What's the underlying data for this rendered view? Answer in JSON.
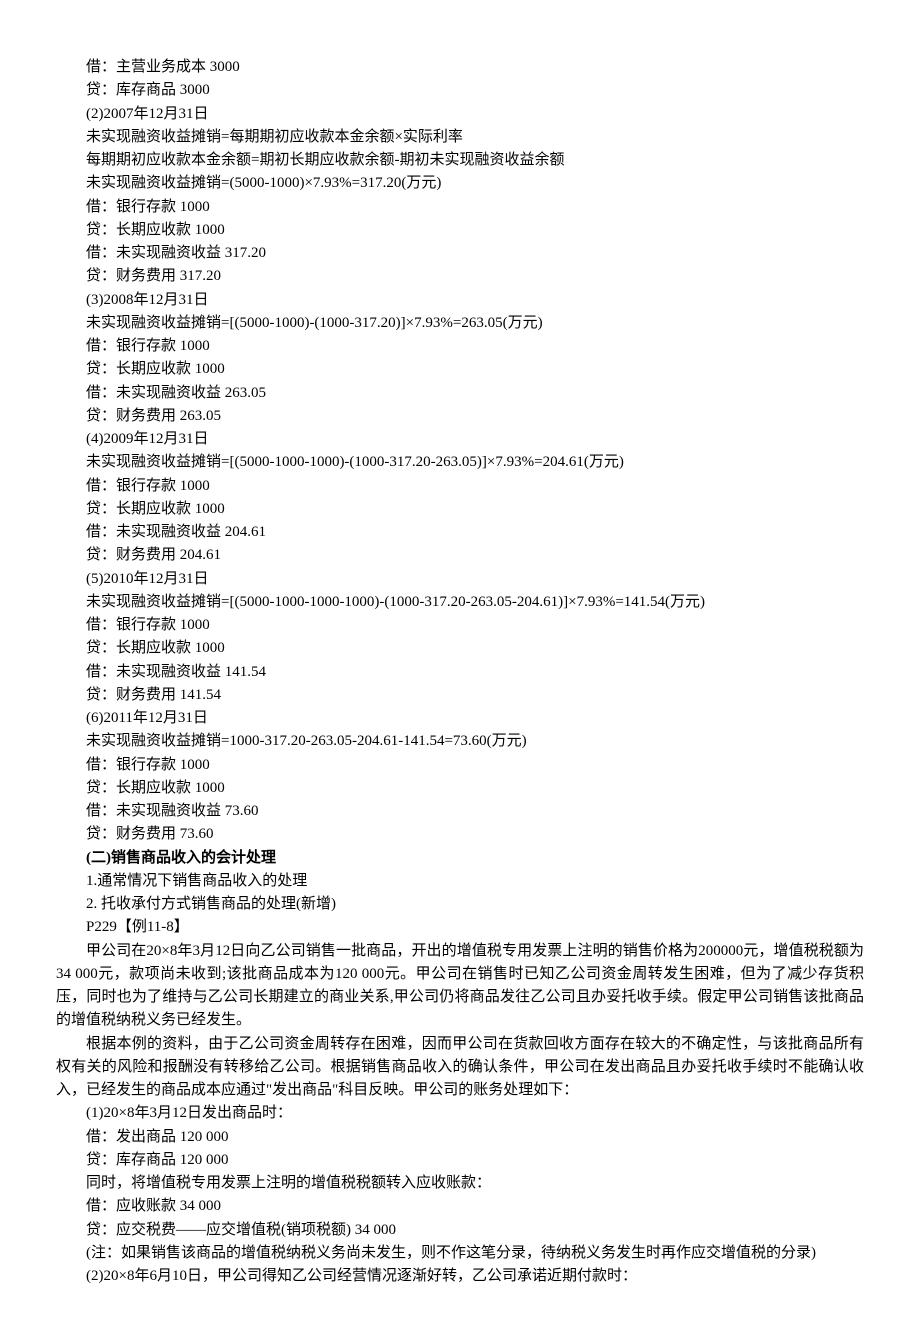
{
  "lines": [
    {
      "t": "借：主营业务成本 3000",
      "cls": "line"
    },
    {
      "t": "贷：库存商品 3000",
      "cls": "line"
    },
    {
      "t": "(2)2007年12月31日",
      "cls": "line"
    },
    {
      "t": "未实现融资收益摊销=每期期初应收款本金余额×实际利率",
      "cls": "line"
    },
    {
      "t": "每期期初应收款本金余额=期初长期应收款余额-期初未实现融资收益余额",
      "cls": "line"
    },
    {
      "t": "未实现融资收益摊销=(5000-1000)×7.93%=317.20(万元)",
      "cls": "line"
    },
    {
      "t": "借：银行存款 1000",
      "cls": "line"
    },
    {
      "t": "贷：长期应收款 1000",
      "cls": "line"
    },
    {
      "t": "借：未实现融资收益 317.20",
      "cls": "line"
    },
    {
      "t": "贷：财务费用 317.20",
      "cls": "line"
    },
    {
      "t": "(3)2008年12月31日",
      "cls": "line"
    },
    {
      "t": "未实现融资收益摊销=[(5000-1000)-(1000-317.20)]×7.93%=263.05(万元)",
      "cls": "line"
    },
    {
      "t": "借：银行存款 1000",
      "cls": "line"
    },
    {
      "t": "贷：长期应收款 1000",
      "cls": "line"
    },
    {
      "t": "借：未实现融资收益 263.05",
      "cls": "line"
    },
    {
      "t": "贷：财务费用 263.05",
      "cls": "line"
    },
    {
      "t": "(4)2009年12月31日",
      "cls": "line"
    },
    {
      "t": "未实现融资收益摊销=[(5000-1000-1000)-(1000-317.20-263.05)]×7.93%=204.61(万元)",
      "cls": "line"
    },
    {
      "t": "借：银行存款 1000",
      "cls": "line"
    },
    {
      "t": "贷：长期应收款 1000",
      "cls": "line"
    },
    {
      "t": "借：未实现融资收益 204.61",
      "cls": "line"
    },
    {
      "t": "贷：财务费用 204.61",
      "cls": "line"
    },
    {
      "t": "(5)2010年12月31日",
      "cls": "line"
    },
    {
      "t": "未实现融资收益摊销=[(5000-1000-1000-1000)-(1000-317.20-263.05-204.61)]×7.93%=141.54(万元)",
      "cls": "line"
    },
    {
      "t": "借：银行存款 1000",
      "cls": "line"
    },
    {
      "t": "贷：长期应收款 1000",
      "cls": "line"
    },
    {
      "t": "借：未实现融资收益 141.54",
      "cls": "line"
    },
    {
      "t": "贷：财务费用 141.54",
      "cls": "line"
    },
    {
      "t": "(6)2011年12月31日",
      "cls": "line"
    },
    {
      "t": "未实现融资收益摊销=1000-317.20-263.05-204.61-141.54=73.60(万元)",
      "cls": "line"
    },
    {
      "t": "借：银行存款 1000",
      "cls": "line"
    },
    {
      "t": "贷：长期应收款 1000",
      "cls": "line"
    },
    {
      "t": "借：未实现融资收益 73.60",
      "cls": "line"
    },
    {
      "t": "贷：财务费用 73.60",
      "cls": "line"
    },
    {
      "t": "(二)销售商品收入的会计处理",
      "cls": "line bold"
    },
    {
      "t": "1.通常情况下销售商品收入的处理",
      "cls": "line"
    },
    {
      "t": "2. 托收承付方式销售商品的处理(新增)",
      "cls": "line"
    },
    {
      "t": "P229【例11-8】",
      "cls": "line"
    },
    {
      "t": "甲公司在20×8年3月12日向乙公司销售一批商品，开出的增值税专用发票上注明的销售价格为200000元，增值税税额为34 000元，款项尚未收到;该批商品成本为120 000元。甲公司在销售时已知乙公司资金周转发生困难，但为了减少存货积压，同时也为了维持与乙公司长期建立的商业关系,甲公司仍将商品发往乙公司且办妥托收手续。假定甲公司销售该批商品的增值税纳税义务已经发生。",
      "cls": "para"
    },
    {
      "t": "根据本例的资料，由于乙公司资金周转存在困难，因而甲公司在货款回收方面存在较大的不确定性，与该批商品所有权有关的风险和报酬没有转移给乙公司。根据销售商品收入的确认条件，甲公司在发出商品且办妥托收手续时不能确认收入，已经发生的商品成本应通过\"发出商品\"科目反映。甲公司的账务处理如下：",
      "cls": "para"
    },
    {
      "t": "(1)20×8年3月12日发出商品时：",
      "cls": "line"
    },
    {
      "t": "借：发出商品 120 000",
      "cls": "line"
    },
    {
      "t": "贷：库存商品 120 000",
      "cls": "line"
    },
    {
      "t": "同时，将增值税专用发票上注明的增值税税额转入应收账款：",
      "cls": "line"
    },
    {
      "t": "借：应收账款 34 000",
      "cls": "line"
    },
    {
      "t": "贷：应交税费——应交增值税(销项税额) 34 000",
      "cls": "line"
    },
    {
      "t": "(注：如果销售该商品的增值税纳税义务尚未发生，则不作这笔分录，待纳税义务发生时再作应交增值税的分录)",
      "cls": "para"
    },
    {
      "t": "(2)20×8年6月10日，甲公司得知乙公司经营情况逐渐好转，乙公司承诺近期付款时：",
      "cls": "line"
    }
  ]
}
